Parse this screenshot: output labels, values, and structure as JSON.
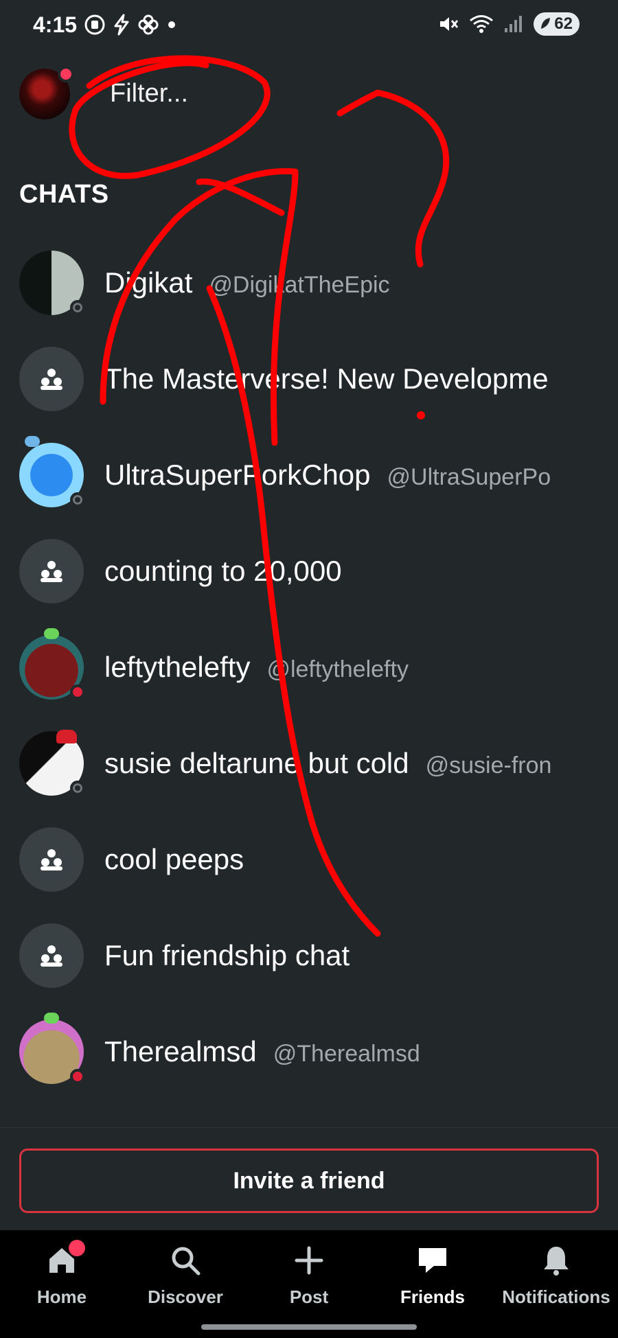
{
  "status_bar": {
    "time": "4:15",
    "battery": "62",
    "icons": [
      "dnd-icon",
      "flash-icon",
      "fan-icon",
      "dot-icon",
      "mute-icon",
      "wifi-icon",
      "signal-icon",
      "battery-icon"
    ]
  },
  "header": {
    "filter_placeholder": "Filter..."
  },
  "section_title": "CHATS",
  "chats": [
    {
      "name": "Digikat",
      "handle": "@DigikatTheEpic",
      "type": "user",
      "presence": "offline"
    },
    {
      "name": "The Masterverse! New Developme",
      "handle": "",
      "type": "group"
    },
    {
      "name": "UltraSuperPorkChop",
      "handle": "@UltraSuperPo",
      "type": "user",
      "presence": "offline"
    },
    {
      "name": "counting to 20,000",
      "handle": "",
      "type": "group"
    },
    {
      "name": "leftythelefty",
      "handle": "@leftythelefty",
      "type": "user",
      "presence": "busy"
    },
    {
      "name": "susie deltarune but cold",
      "handle": "@susie-fron",
      "type": "user",
      "presence": "offline"
    },
    {
      "name": "cool peeps",
      "handle": "",
      "type": "group"
    },
    {
      "name": "Fun friendship chat",
      "handle": "",
      "type": "group"
    },
    {
      "name": "Therealmsd",
      "handle": "@Therealmsd",
      "type": "user",
      "presence": "busy"
    }
  ],
  "invite_button": "Invite a friend",
  "nav": {
    "home": "Home",
    "discover": "Discover",
    "post": "Post",
    "friends": "Friends",
    "notifications": "Notifications",
    "active": "friends"
  },
  "colors": {
    "background": "#22272a",
    "accent_red": "#d8343f",
    "badge_pink": "#ff3a5c",
    "scribble_red": "#ff0000"
  }
}
